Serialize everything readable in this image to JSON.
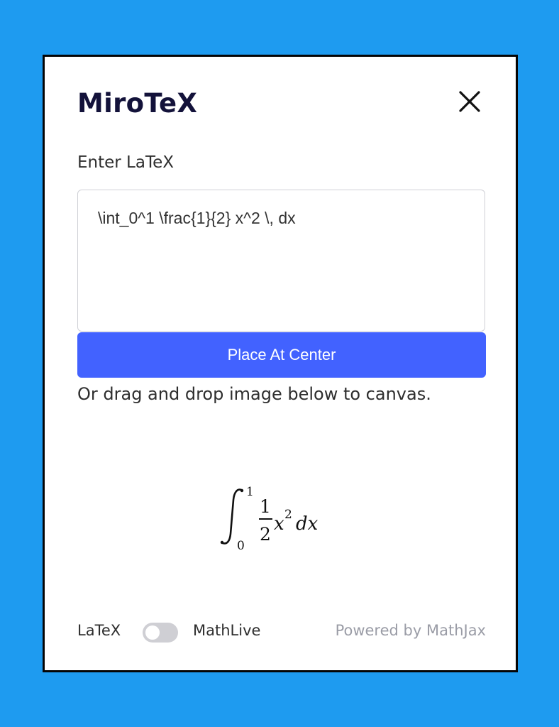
{
  "app": {
    "title": "MiroTeX"
  },
  "editor": {
    "label": "Enter LaTeX",
    "value": "\\int_0^1 \\frac{1}{2} x^2 \\, dx"
  },
  "actions": {
    "place_label": "Place At Center"
  },
  "hint": "Or drag and drop image below to canvas.",
  "preview": {
    "integral_lower": "0",
    "integral_upper": "1",
    "numerator": "1",
    "denominator": "2",
    "variable": "x",
    "exponent": "2",
    "differential": "dx"
  },
  "footer": {
    "mode_left": "LaTeX",
    "mode_right": "MathLive",
    "mode_toggle_on": false,
    "powered_by": "Powered by MathJax"
  },
  "icons": {
    "close": "close-icon"
  },
  "colors": {
    "background": "#1e9bf0",
    "button": "#4262ff",
    "title": "#13123a",
    "muted_text": "#9a9ca6"
  }
}
